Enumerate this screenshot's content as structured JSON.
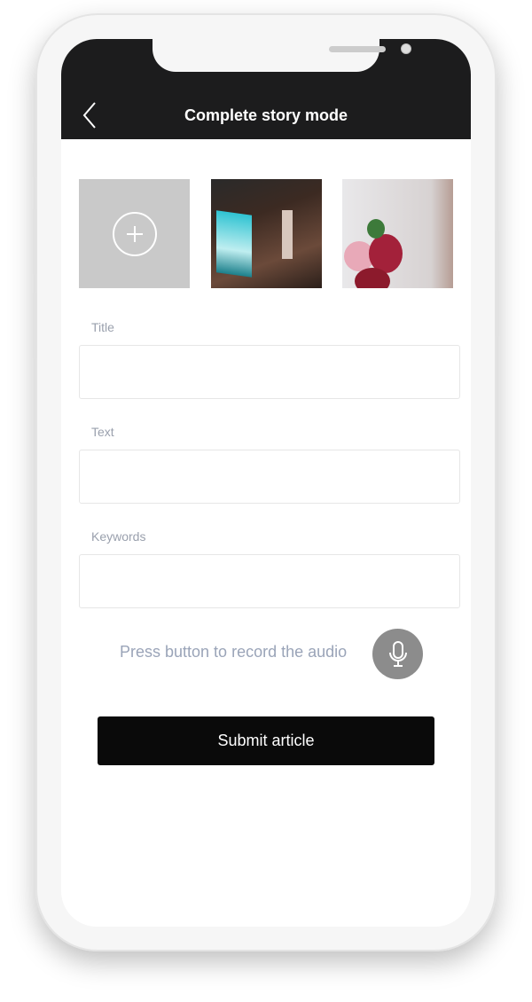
{
  "header": {
    "title": "Complete story mode",
    "back_icon": "chevron-left-icon"
  },
  "photos": {
    "add_icon": "plus-circle-icon",
    "items": [
      "photo-stairs-poster",
      "photo-flowers"
    ]
  },
  "form": {
    "title_label": "Title",
    "text_label": "Text",
    "keywords_label": "Keywords",
    "title_value": "",
    "text_value": "",
    "keywords_value": ""
  },
  "audio": {
    "prompt": "Press button to record the audio",
    "icon": "microphone-icon"
  },
  "submit_label": "Submit article"
}
